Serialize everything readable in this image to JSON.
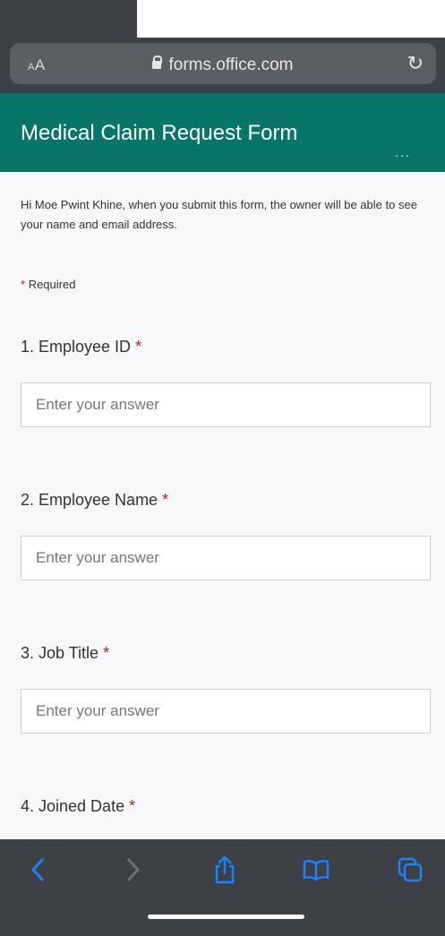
{
  "browser": {
    "text_size_label": "AA",
    "url": "forms.office.com"
  },
  "form": {
    "title": "Medical Claim Request Form",
    "more_label": "...",
    "intro": "Hi Moe Pwint Khine, when you submit this form, the owner will be able to see your name and email address.",
    "required_note": "Required",
    "required_marker": "*",
    "questions": [
      {
        "label": "1. Employee ID",
        "placeholder": "Enter your answer"
      },
      {
        "label": "2. Employee Name",
        "placeholder": "Enter your answer"
      },
      {
        "label": "3. Job Title",
        "placeholder": "Enter your answer"
      },
      {
        "label": "4. Joined Date"
      }
    ]
  },
  "toolbar": {
    "icons": [
      "back-icon",
      "forward-icon",
      "share-icon",
      "bookmarks-icon",
      "tabs-icon"
    ]
  },
  "colors": {
    "header": "#077568",
    "accent_icon": "#1a82ff",
    "required": "#a4262c",
    "safari_chrome": "#3d4145"
  }
}
